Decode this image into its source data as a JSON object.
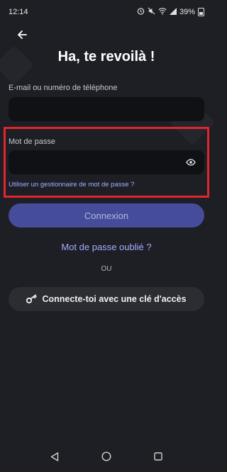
{
  "status_bar": {
    "time": "12:14",
    "battery": "39%"
  },
  "page": {
    "title": "Ha, te revoilà !"
  },
  "email": {
    "label": "E-mail ou numéro de téléphone",
    "value": ""
  },
  "password": {
    "label": "Mot de passe",
    "value": "",
    "manager_link": "Utiliser un gestionnaire de mot de passe ?"
  },
  "actions": {
    "login_label": "Connexion",
    "forgot_label": "Mot de passe oublié ?",
    "or_label": "OU",
    "passkey_label": "Connecte-toi avec une clé d'accès"
  },
  "colors": {
    "accent": "#a5acff",
    "button": "#454c9a",
    "highlight": "#e0262f",
    "background": "#1e1f24"
  },
  "icons": [
    "back-arrow-icon",
    "eye-icon",
    "key-icon",
    "nav-back-icon",
    "nav-home-icon",
    "nav-recents-icon"
  ]
}
